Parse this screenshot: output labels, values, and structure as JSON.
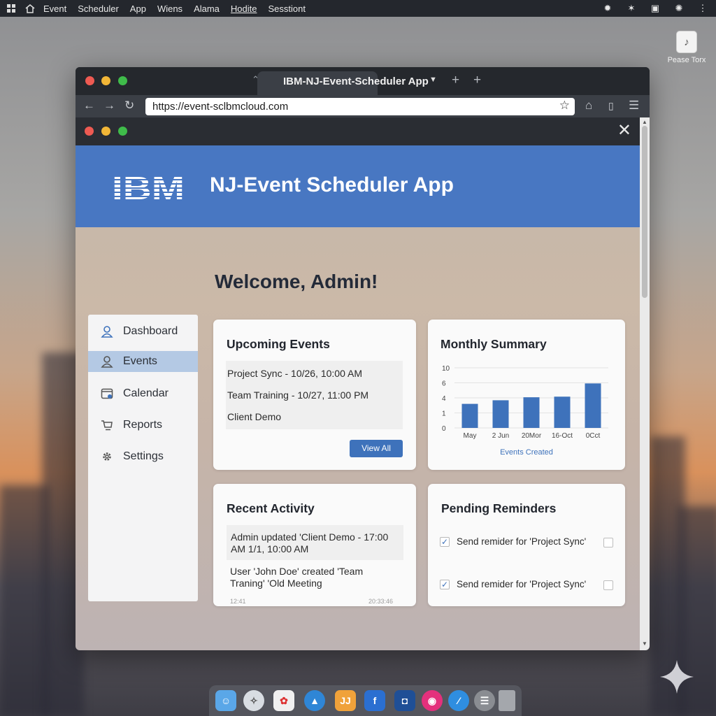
{
  "menubar": {
    "items": [
      "Event",
      "Scheduler",
      "App",
      "Wiens",
      "Alama",
      "Hodite",
      "Sesstiont"
    ]
  },
  "desktop_icon": {
    "label": "Pease Torx"
  },
  "browser": {
    "tab_title": "IBM-NJ-Event-Scheduler App",
    "url": "https://event-sclbmcloud.com"
  },
  "app": {
    "title": "NJ-Event Scheduler App",
    "welcome": "Welcome, Admin!",
    "brand_color": "#4877c2"
  },
  "sidebar": {
    "items": [
      {
        "label": "Dashboard",
        "icon": "user-icon"
      },
      {
        "label": "Events",
        "icon": "user-icon",
        "active": true
      },
      {
        "label": "Calendar",
        "icon": "calendar-icon"
      },
      {
        "label": "Reports",
        "icon": "cart-icon"
      },
      {
        "label": "Settings",
        "icon": "gear-icon"
      }
    ]
  },
  "upcoming": {
    "title": "Upcoming Events",
    "events": [
      "Project Sync - 10/26, 10:00 AM",
      "Team Training - 10/27, 11:00 PM",
      "Client Demo"
    ],
    "view_all": "View All"
  },
  "summary": {
    "title": "Monthly Summary",
    "caption": "Events Created"
  },
  "chart_data": {
    "type": "bar",
    "categories": [
      "May",
      "2 Jun",
      "20Mor",
      "16-Oct",
      "0Cct"
    ],
    "values": [
      4,
      4.6,
      5.1,
      5.2,
      7.4
    ],
    "y_ticks": [
      "10",
      "6",
      "4",
      "1",
      "0"
    ],
    "xlabel": "Events Created",
    "ylim": [
      0,
      10
    ],
    "grid": true,
    "bar_color": "#3e72bb"
  },
  "activity": {
    "title": "Recent Activity",
    "items": [
      "Admin updated 'Client Demo - 17:00 AM 1/1, 10:00 AM",
      "User 'John Doe' created 'Team Traning' 'Old Meeting"
    ],
    "stamps": [
      "12:41",
      "20:33:46"
    ]
  },
  "reminders": {
    "title": "Pending Reminders",
    "items": [
      {
        "label": "Send remider for 'Project Sync'",
        "checked": true
      },
      {
        "label": "Send remider for 'Project Sync'",
        "checked": true
      }
    ]
  }
}
